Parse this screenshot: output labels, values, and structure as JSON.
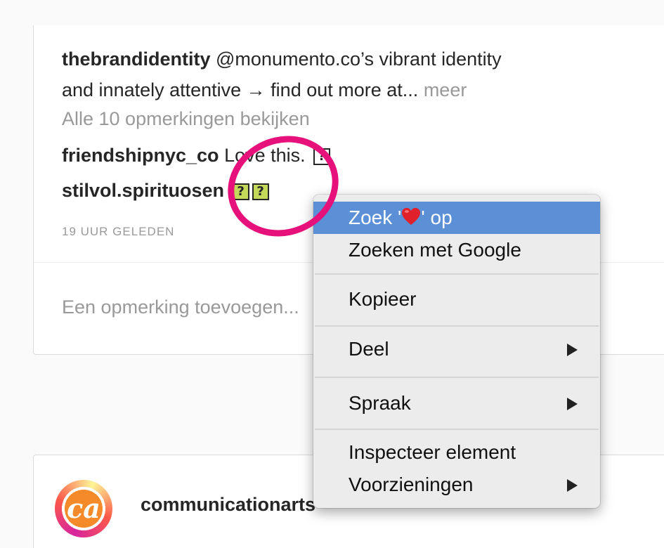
{
  "post": {
    "caption_user": "thebrandidentity",
    "caption_line1": " @monumento.co’s vibrant identity",
    "caption_line2": "and innately attentive → find out more at...",
    "more_label": "meer",
    "view_all_comments": "Alle 10 opmerkingen bekijken",
    "comments": [
      {
        "user": "friendshipnyc_co",
        "text": " Love this.",
        "glyphs": [
          "?"
        ]
      },
      {
        "user": "stilvol.spirituosen",
        "text": "",
        "glyphs": [
          "?",
          "?"
        ]
      }
    ],
    "timestamp": "19 UUR GELEDEN",
    "add_comment_placeholder": "Een opmerking toevoegen..."
  },
  "next_post": {
    "username": "communicationarts",
    "avatar_text": "ca"
  },
  "context_menu": {
    "items": [
      {
        "pre": "Zoek '",
        "icon": "heart-emoji-icon",
        "post": "' op",
        "active": true,
        "submenu": false
      },
      {
        "label": "Zoeken met Google",
        "active": false,
        "submenu": false
      },
      {
        "label": "Kopieer",
        "active": false,
        "submenu": false
      },
      {
        "label": "Deel",
        "active": false,
        "submenu": true
      },
      {
        "label": "Spraak",
        "active": false,
        "submenu": true
      },
      {
        "label": "Inspecteer element",
        "active": false,
        "submenu": false
      },
      {
        "label": "Voorzieningen",
        "active": false,
        "submenu": true
      }
    ]
  },
  "colors": {
    "highlight": "#5b8fd6",
    "annotation_ring": "#e6117a",
    "glyph_highlight": "#c4d85a"
  }
}
